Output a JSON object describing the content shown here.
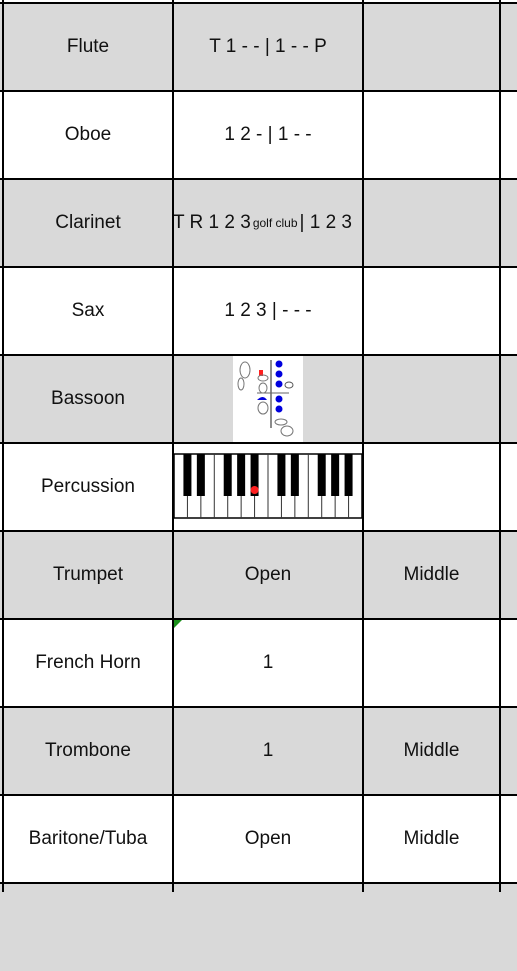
{
  "rows": [
    {
      "instrument": "Flute",
      "fingering": "T 1 - - | 1 - - P",
      "register": ""
    },
    {
      "instrument": "Oboe",
      "fingering": "1 2 - | 1 - -",
      "register": ""
    },
    {
      "instrument": "Clarinet",
      "fingering_pre": "T R 1 2 3",
      "fingering_sup": "golf club",
      "fingering_post": "| 1 2 3",
      "register": ""
    },
    {
      "instrument": "Sax",
      "fingering": "1 2 3 | - - -",
      "register": ""
    },
    {
      "instrument": "Bassoon",
      "fingering_image": "bassoon-fingering-chart",
      "register": ""
    },
    {
      "instrument": "Percussion",
      "fingering_image": "piano-keyboard",
      "register": ""
    },
    {
      "instrument": "Trumpet",
      "fingering": "Open",
      "register": "Middle"
    },
    {
      "instrument": "French Horn",
      "fingering": "1",
      "register": ""
    },
    {
      "instrument": "Trombone",
      "fingering": "1",
      "register": "Middle"
    },
    {
      "instrument": "Baritone/Tuba",
      "fingering": "Open",
      "register": "Middle"
    }
  ],
  "colors": {
    "row_alt": "#d9d9d9",
    "key_marker": "#ff2020",
    "bassoon_key": "#0000dd",
    "comment_flag": "#1a8f1a"
  }
}
